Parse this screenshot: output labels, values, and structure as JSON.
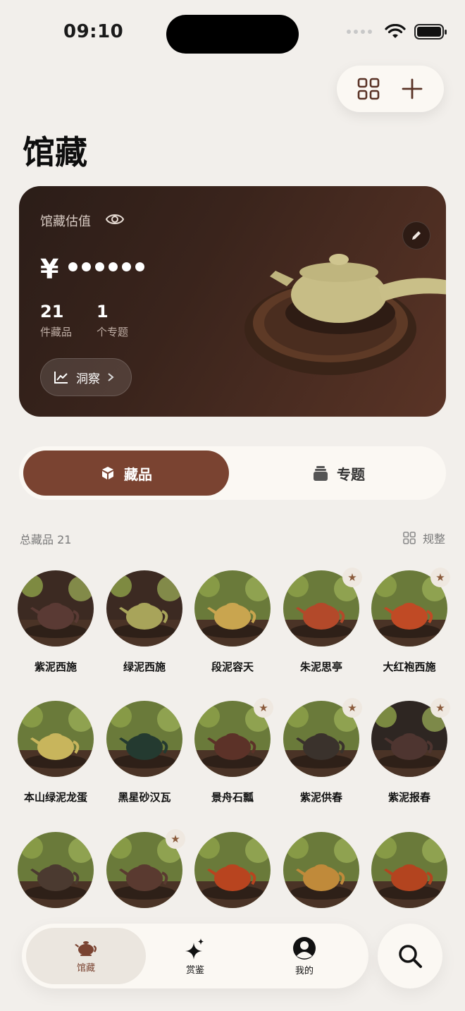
{
  "status": {
    "time": "09:10"
  },
  "page": {
    "title": "馆藏"
  },
  "value_card": {
    "label": "馆藏估值",
    "currency": "¥",
    "masked_dots": 6,
    "stats": [
      {
        "num": "21",
        "label": "件藏品"
      },
      {
        "num": "1",
        "label": "个专题"
      }
    ],
    "insight_label": "洞察"
  },
  "segments": {
    "items_label": "藏品",
    "topics_label": "专题",
    "active": "items"
  },
  "list": {
    "count_label": "总藏品 21",
    "sort_label": "规整"
  },
  "items": [
    {
      "name": "紫泥西施",
      "starred": false,
      "body": "#5a3a34",
      "bg": "#3c2a22"
    },
    {
      "name": "绿泥西施",
      "starred": false,
      "body": "#a8a45a",
      "bg": "#3c2a22"
    },
    {
      "name": "段泥容天",
      "starred": false,
      "body": "#c9a54f",
      "bg": "#6a7a3a"
    },
    {
      "name": "朱泥思亭",
      "starred": true,
      "body": "#b3492a",
      "bg": "#6a7a3a"
    },
    {
      "name": "大红袍西施",
      "starred": true,
      "body": "#c04a25",
      "bg": "#6a7a3a"
    },
    {
      "name": "本山绿泥龙蛋",
      "starred": false,
      "body": "#c8b55c",
      "bg": "#6a7a3a"
    },
    {
      "name": "黑星砂汉瓦",
      "starred": false,
      "body": "#243a30",
      "bg": "#6a7a3a"
    },
    {
      "name": "景舟石瓢",
      "starred": true,
      "body": "#5c3228",
      "bg": "#6a7a3a"
    },
    {
      "name": "紫泥供春",
      "starred": true,
      "body": "#3a322c",
      "bg": "#6a7a3a"
    },
    {
      "name": "紫泥报春",
      "starred": true,
      "body": "#4e3530",
      "bg": "#2e2622"
    },
    {
      "name": "",
      "starred": false,
      "body": "#4b3a30",
      "bg": "#6a7a3a"
    },
    {
      "name": "",
      "starred": true,
      "body": "#5a3a30",
      "bg": "#6a7a3a"
    },
    {
      "name": "",
      "starred": false,
      "body": "#b8441f",
      "bg": "#6a7a3a"
    },
    {
      "name": "",
      "starred": false,
      "body": "#c08a3a",
      "bg": "#6a7a3a"
    },
    {
      "name": "",
      "starred": false,
      "body": "#b3441f",
      "bg": "#6a7a3a"
    }
  ],
  "tabs": [
    {
      "label": "馆藏",
      "icon": "teapot-icon",
      "active": true
    },
    {
      "label": "赏鉴",
      "icon": "sparkle-icon",
      "active": false
    },
    {
      "label": "我的",
      "icon": "profile-icon",
      "active": false
    }
  ],
  "colors": {
    "accent": "#7a4331",
    "background": "#f2efeb",
    "card": "#fbf8f3"
  }
}
